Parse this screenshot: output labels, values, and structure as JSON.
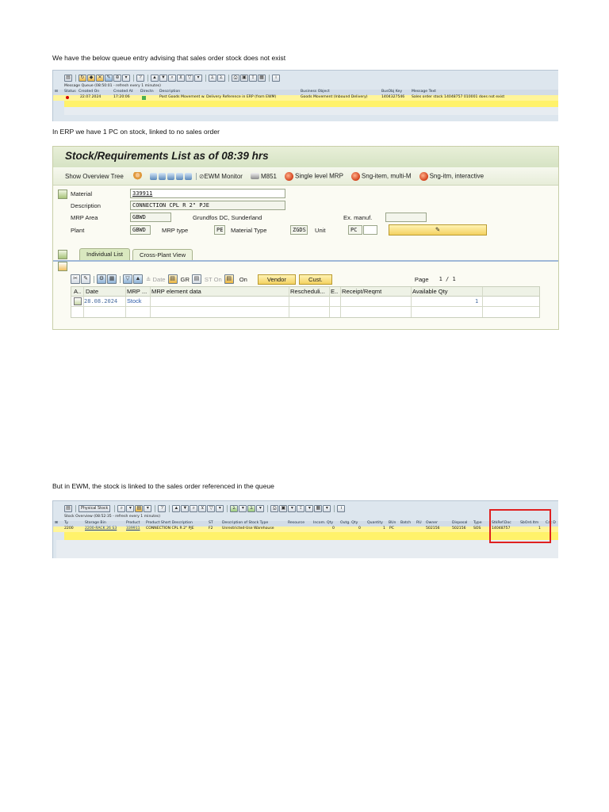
{
  "intro_text": "We have the below queue entry advising that sales order stock does not exist",
  "erp_text": "In ERP we have 1 PC on stock, linked to no sales order",
  "ewm_text": "But in EWM, the stock is linked to the sales order referenced in the queue",
  "queue": {
    "title": "Message Queue (08:50:01 - refresh every 1 minutes)",
    "headers": [
      "Status",
      "Created On",
      "Created At",
      "Directn",
      "Description",
      "Business Object",
      "BusObj Key",
      "Message Text"
    ],
    "row": {
      "created_on": "22.07.2024",
      "created_at": "17:20:06",
      "description": "Post Goods Movement w. Delivery Reference in ERP (from EWM)",
      "business_object": "Goods Movement (Inbound Delivery)",
      "busobj_key": "1404327546",
      "message_text": "Sales order stock 14048757 010001 does not exist"
    }
  },
  "stock": {
    "title": "Stock/Requirements List as of 08:39 hrs",
    "toolbar": {
      "show_overview_tree": "Show Overview Tree",
      "ewm_monitor": "EWM Monitor",
      "m851": "M851",
      "single_level_mrp": "Single level MRP",
      "sng_item_multi": "Sng-item, multi-M",
      "sng_itm_interactive": "Sng-itm, interactive"
    },
    "labels": {
      "material": "Material",
      "description": "Description",
      "mrp_area": "MRP Area",
      "plant": "Plant",
      "mrp_type": "MRP type",
      "material_type": "Material Type",
      "unit": "Unit",
      "ex_manuf": "Ex. manuf."
    },
    "values": {
      "material": "339911",
      "description": "CONNECTION CPL R 2\" PJE",
      "mrp_area": "GBWD",
      "mrp_area_desc": "Grundfos DC, Sunderland",
      "plant": "GBWD",
      "mrp_type": "PE",
      "material_type": "ZGDS",
      "unit": "PC"
    },
    "tabs": [
      "Individual List",
      "Cross-Plant View"
    ],
    "list_toolbar": {
      "date": "Date",
      "gr": "GR",
      "st_on": "ST On",
      "on": "On",
      "vendor": "Vendor",
      "cust": "Cust.",
      "page_label": "Page",
      "page_value": "1 / 1"
    },
    "columns": [
      "A..",
      "Date",
      "MRP ...",
      "MRP element data",
      "Rescheduli...",
      "E..",
      "Receipt/Reqmt",
      "Available Qty"
    ],
    "row": {
      "date": "28.08.2024",
      "mrp_element": "Stock",
      "available_qty": "1"
    }
  },
  "ewm": {
    "physical_stock_btn": "Physical Stock",
    "title": "Stock Overview (08:52:35 - refresh every 1 minutes)",
    "headers": [
      "Ty.",
      "Storage Bin",
      "Product",
      "Product Short Description",
      "ST",
      "Description of Stock Type",
      "Resource",
      "Incom. Qty",
      "Outg. Qty",
      "Quantity",
      "BUn",
      "Batch",
      "RU",
      "Owner",
      "Disposal",
      "Type",
      "StkRef.Doc",
      "SbOrd.Itm",
      "Cat D"
    ],
    "row": {
      "type": "2200",
      "storage_bin": "2200-RACK 26 S3",
      "product": "339911",
      "short_desc": "CONNECTION CPL R 2\" PJE",
      "st": "F2",
      "stock_type_desc": "Unrestricted-Use Warehouse",
      "incom_qty": "0",
      "outg_qty": "0",
      "quantity": "1",
      "bun": "PC",
      "owner": "502156",
      "disposal": "502156",
      "type2": "SOS",
      "stkref_doc": "14048757",
      "sbord_itm": "1"
    }
  },
  "colors": {
    "highlight": "#e02020",
    "yellow_row": "#fff26a",
    "sap_green": "#d6e3c4"
  }
}
